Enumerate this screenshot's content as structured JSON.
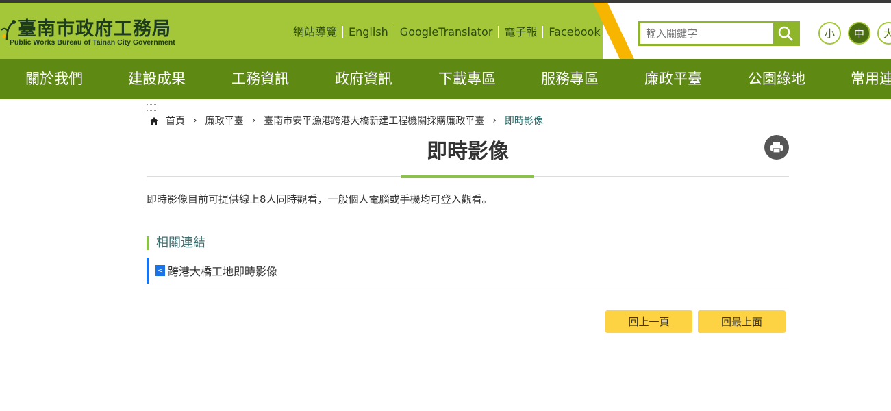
{
  "header": {
    "title": "臺南市政府工務局",
    "subtitle": "Public Works Bureau of Tainan City Government",
    "links": [
      "網站導覽",
      "English",
      "GoogleTranslator",
      "電子報",
      "Facebook"
    ],
    "search_placeholder": "輸入關鍵字",
    "font_sizes": [
      "小",
      "中",
      "大"
    ]
  },
  "nav": {
    "items": [
      "關於我們",
      "建設成果",
      "工務資訊",
      "政府資訊",
      "下載專區",
      "服務專區",
      "廉政平臺",
      "公園綠地",
      "常用連"
    ]
  },
  "breadcrumb": {
    "items": [
      "首頁",
      "廉政平臺",
      "臺南市安平漁港跨港大橋新建工程機關採購廉政平臺",
      "即時影像"
    ]
  },
  "main": {
    "title": "即時影像",
    "intro": "即時影像目前可提供線上8人同時觀看，一般個人電腦或手機均可登入觀看。",
    "related_heading": "相關連結",
    "related_link": "跨港大橋工地即時影像"
  },
  "buttons": {
    "back": "回上一頁",
    "top": "回最上面"
  },
  "colors": {
    "header_green": "#a4c639",
    "nav_green": "#5e8a14",
    "accent_yellow": "#f7b500",
    "button_yellow": "#fdd343"
  }
}
